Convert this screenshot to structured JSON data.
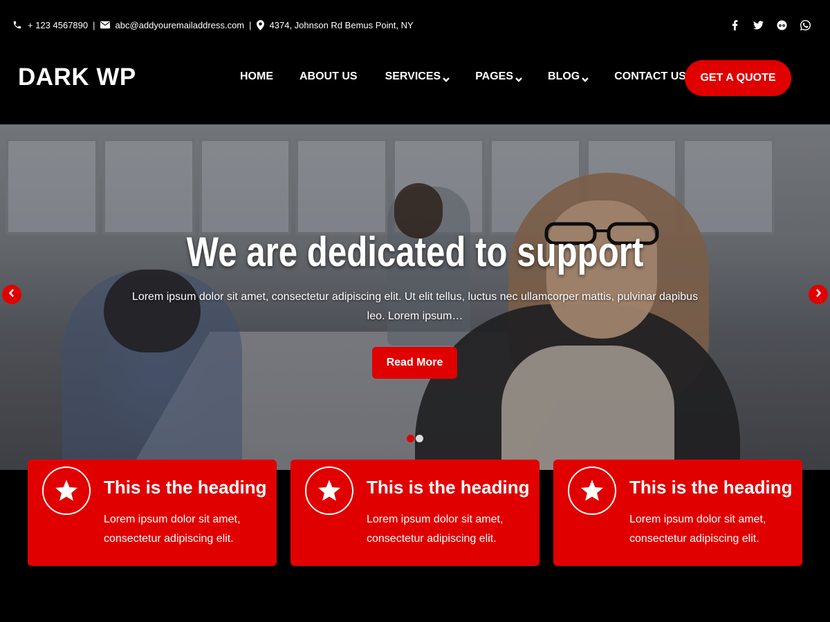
{
  "topbar": {
    "phone": "+ 123 4567890",
    "email": "abc@addyouremailaddress.com",
    "address": "4374, Johnson Rd Bemus Point, NY",
    "separator": "|",
    "social_icons": [
      "facebook-icon",
      "twitter-icon",
      "tripadvisor-icon",
      "whatsapp-icon"
    ]
  },
  "header": {
    "logo": "DARK WP",
    "nav": [
      {
        "label": "HOME",
        "dropdown": false
      },
      {
        "label": "ABOUT US",
        "dropdown": false
      },
      {
        "label": "SERVICES",
        "dropdown": true
      },
      {
        "label": "PAGES",
        "dropdown": true
      },
      {
        "label": "BLOG",
        "dropdown": true
      },
      {
        "label": "CONTACT US",
        "dropdown": false
      }
    ],
    "cta_label": "GET A QUOTE"
  },
  "hero": {
    "title": "We are dedicated to support",
    "text": "Lorem ipsum dolor sit amet, consectetur adipiscing elit. Ut elit tellus, luctus nec ullamcorper mattis, pulvinar dapibus leo. Lorem ipsum…",
    "button_label": "Read More",
    "slides_count": 2,
    "active_slide": 1
  },
  "features": [
    {
      "title": "This is the heading",
      "text": "Lorem ipsum dolor sit amet, consectetur adipiscing elit.",
      "icon": "star-icon"
    },
    {
      "title": "This is the heading",
      "text": "Lorem ipsum dolor sit amet, consectetur adipiscing elit.",
      "icon": "star-icon"
    },
    {
      "title": "This is the heading",
      "text": "Lorem ipsum dolor sit amet, consectetur adipiscing elit.",
      "icon": "star-icon"
    }
  ],
  "colors": {
    "accent": "#e00000",
    "background": "#000000",
    "text": "#ffffff"
  }
}
